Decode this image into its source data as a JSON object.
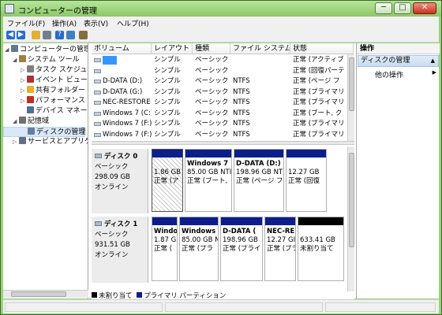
{
  "window": {
    "title": "コンピューターの管理",
    "minimize_glyph": "─",
    "maximize_glyph": "□",
    "close_glyph": "✕"
  },
  "menu": [
    "ファイル(F)",
    "操作(A)",
    "表示(V)",
    "ヘルプ(H)"
  ],
  "toolbar": {
    "icons": [
      "back-arrow-icon",
      "forward-arrow-icon",
      "up-folder-icon",
      "console-tree-icon",
      "help-icon",
      "properties-icon",
      "snapin-icon"
    ],
    "colors": [
      "#2a6ad0",
      "#2a6ad0",
      "#e0b030",
      "#708090",
      "#2a6ad0",
      "#4080c0",
      "#807040"
    ]
  },
  "tree": {
    "items": [
      {
        "label": "コンピューターの管理 (",
        "indent": 0,
        "expander": "◢",
        "icon_color": "#607890",
        "icon": "computer-icon"
      },
      {
        "label": "システム ツール",
        "indent": 1,
        "expander": "◢",
        "icon_color": "#a08040",
        "icon": "tools-icon"
      },
      {
        "label": "タスク スケジュー",
        "indent": 2,
        "expander": "▷",
        "icon_color": "#808080",
        "icon": "clock-icon"
      },
      {
        "label": "イベント ビューア",
        "indent": 2,
        "expander": "▷",
        "icon_color": "#b03030",
        "icon": "event-viewer-icon"
      },
      {
        "label": "共有フォルダー",
        "indent": 2,
        "expander": "▷",
        "icon_color": "#e0b030",
        "icon": "shared-folder-icon"
      },
      {
        "label": "パフォーマンス",
        "indent": 2,
        "expander": "▷",
        "icon_color": "#c03020",
        "icon": "performance-icon"
      },
      {
        "label": "デバイス マネージ",
        "indent": 2,
        "expander": "",
        "icon_color": "#507090",
        "icon": "device-manager-icon"
      },
      {
        "label": "記憶域",
        "indent": 1,
        "expander": "◢",
        "icon_color": "#707070",
        "icon": "storage-icon"
      },
      {
        "label": "ディスクの管理",
        "indent": 2,
        "expander": "",
        "icon_color": "#6080a0",
        "icon": "disk-management-icon",
        "selected": true
      },
      {
        "label": "サービスとアプリケー",
        "indent": 1,
        "expander": "▷",
        "icon_color": "#607080",
        "icon": "services-icon"
      }
    ]
  },
  "volumes": {
    "columns": [
      "ボリューム",
      "レイアウト",
      "種類",
      "ファイル システム",
      "状態"
    ],
    "rows": [
      {
        "name": "",
        "layout": "シンプル",
        "type": "ベーシック",
        "fs": "",
        "status": "正常 (アクティブ",
        "icon_highlight": true
      },
      {
        "name": "",
        "layout": "シンプル",
        "type": "ベーシック",
        "fs": "",
        "status": "正常 (回復パーテ"
      },
      {
        "name": "D-DATA (D:)",
        "layout": "シンプル",
        "type": "ベーシック",
        "fs": "NTFS",
        "status": "正常 (ページ フ"
      },
      {
        "name": "D-DATA (G:)",
        "layout": "シンプル",
        "type": "ベーシック",
        "fs": "NTFS",
        "status": "正常 (プライマリ"
      },
      {
        "name": "NEC-RESTORE",
        "layout": "シンプル",
        "type": "ベーシック",
        "fs": "NTFS",
        "status": "正常 (プライマリ"
      },
      {
        "name": "Windows 7 (C:)",
        "layout": "シンプル",
        "type": "ベーシック",
        "fs": "NTFS",
        "status": "正常 (ブート, ク"
      },
      {
        "name": "Windows 7 (F:)",
        "layout": "シンプル",
        "type": "ベーシック",
        "fs": "NTFS",
        "status": "正常 (プライマリ"
      },
      {
        "name": "Windows 7 (F:)",
        "layout": "シンプル",
        "type": "ベーシック",
        "fs": "NTFS",
        "status": "正常 (プライマリ"
      }
    ]
  },
  "disks": [
    {
      "name": "ディスク 0",
      "type": "ベーシック",
      "size": "298.09 GB",
      "state": "オンライン",
      "partitions": [
        {
          "name": "",
          "size": "1.86 GB",
          "status": "正常 (ア",
          "hatched": true
        },
        {
          "name": "Windows 7",
          "size": "85.00 GB NTI",
          "status": "正常 (ブート,"
        },
        {
          "name": "D-DATA  (D:)",
          "size": "198.96 GB NT",
          "status": "正常 (ページ フ"
        },
        {
          "name": "",
          "size": "12.27 GB",
          "status": "正常 (回復"
        }
      ]
    },
    {
      "name": "ディスク 1",
      "type": "ベーシック",
      "size": "931.51 GB",
      "state": "オンライン",
      "partitions": [
        {
          "name": "Windo",
          "size": "1.87 G",
          "status": "正常 ("
        },
        {
          "name": "Windows",
          "size": "85.00 GB N",
          "status": "正常 (プラ"
        },
        {
          "name": "D-DATA  (",
          "size": "198.96 GB",
          "status": "正常 (プライ"
        },
        {
          "name": "NEC-RE",
          "size": "12.27 GI",
          "status": "正常 (プラ"
        },
        {
          "name": "",
          "size": "633.41 GB",
          "status": "未割り当て",
          "unallocated": true
        }
      ]
    }
  ],
  "legend": [
    {
      "label": "未割り当て",
      "color": "#000000"
    },
    {
      "label": "プライマリ パーティション",
      "color": "#0c1e8c"
    }
  ],
  "actions": {
    "header": "操作",
    "section": "ディスクの管理",
    "section_arrow": "▲",
    "item": "他の操作",
    "item_arrow": "▶"
  }
}
